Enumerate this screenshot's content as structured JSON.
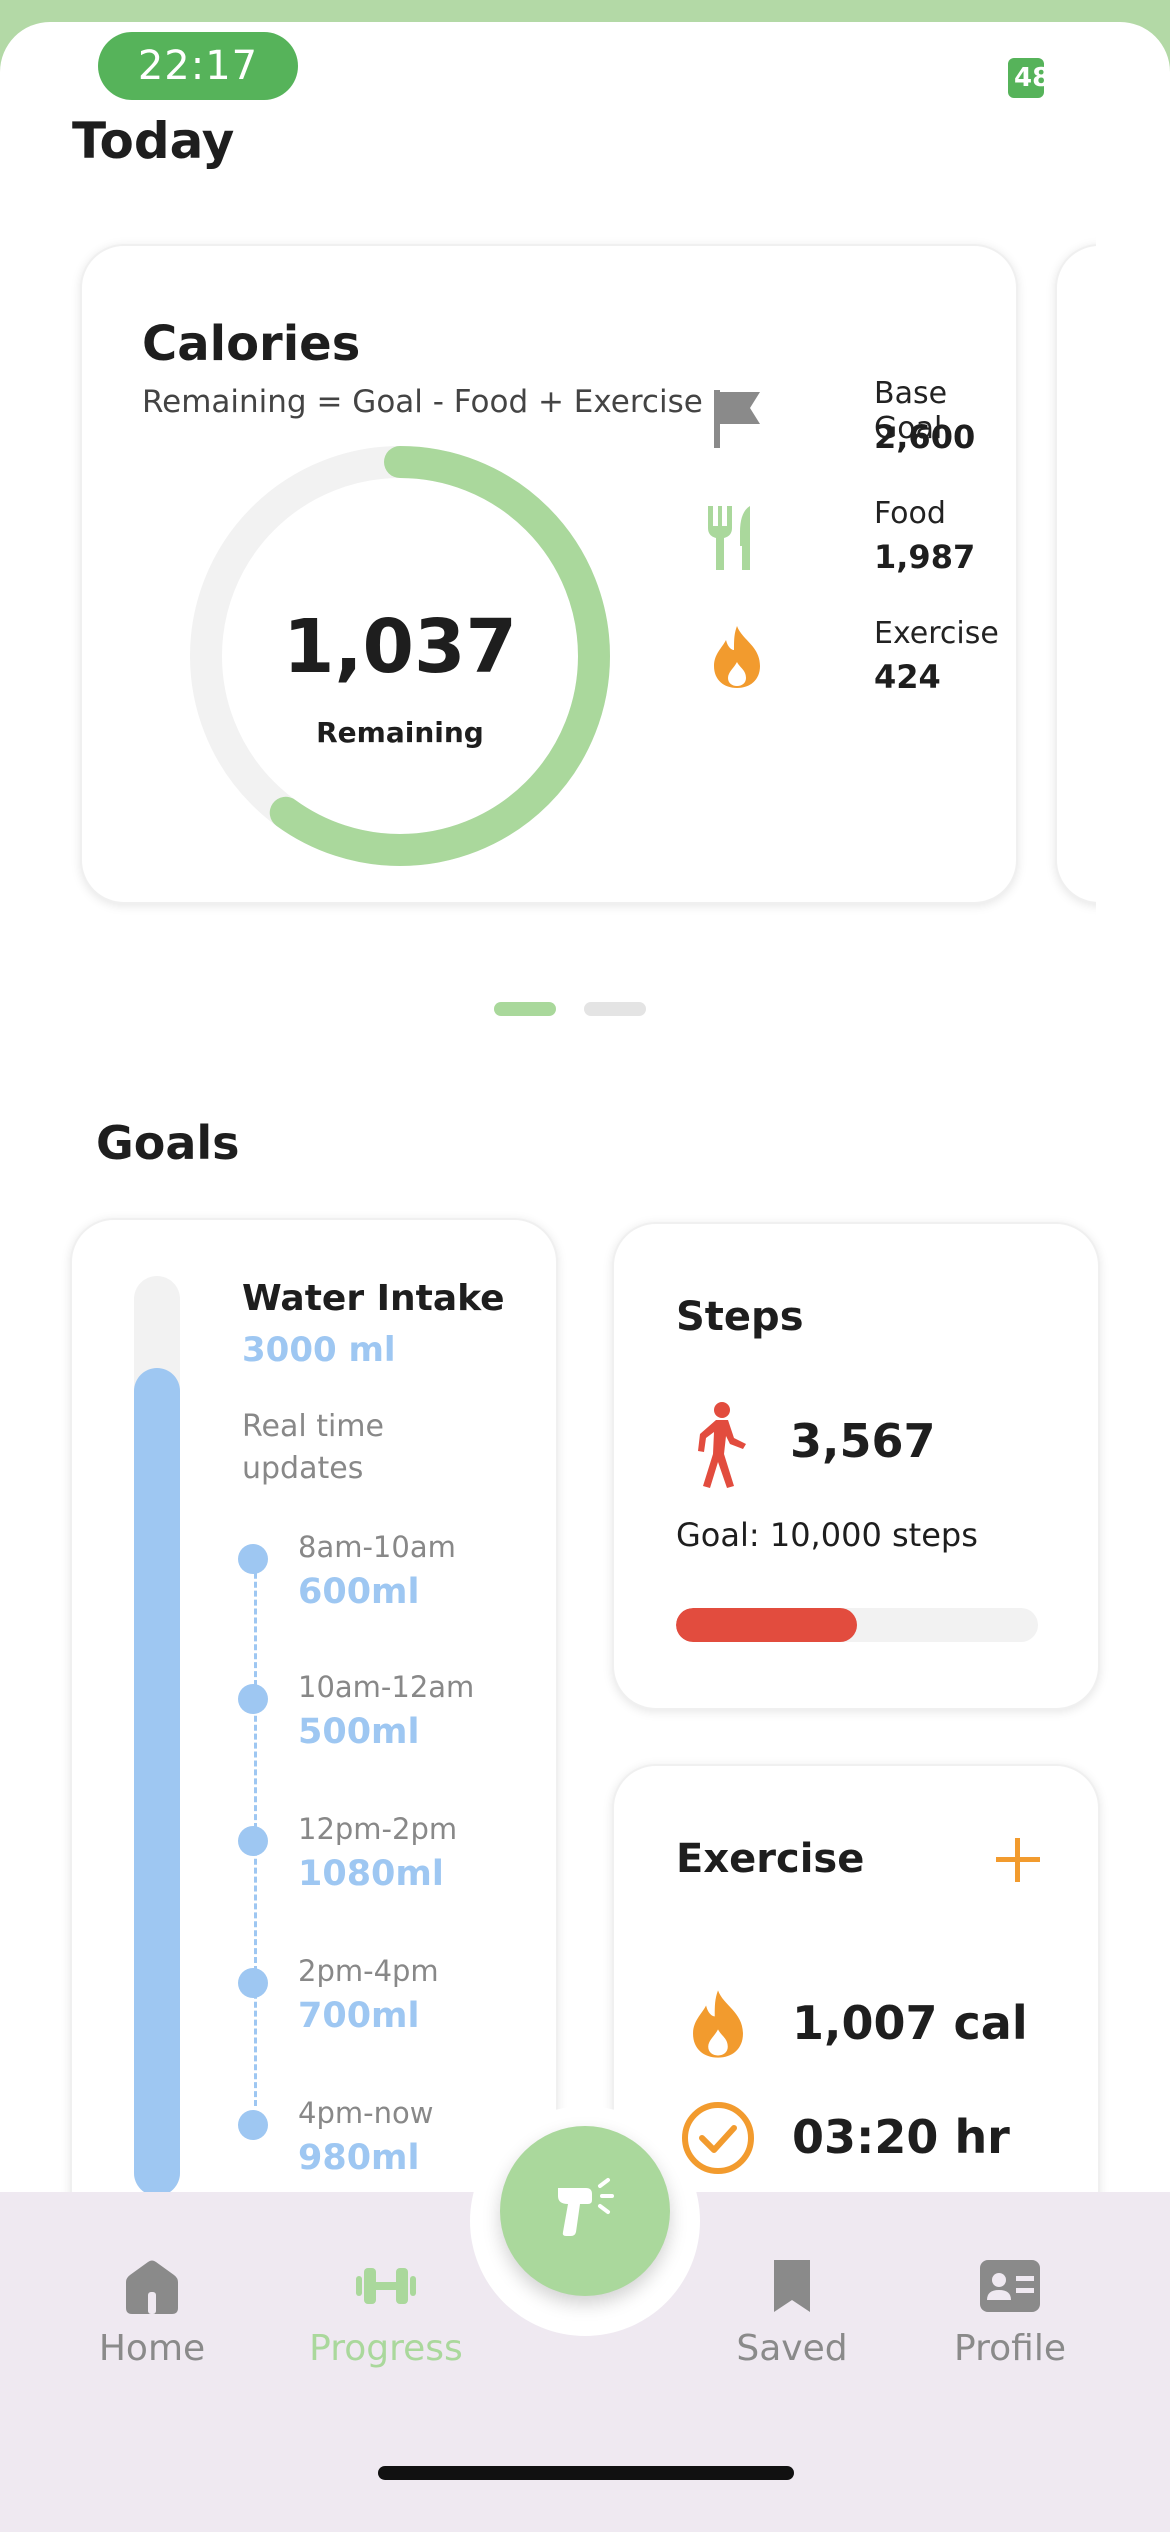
{
  "status_bar": {
    "time": "22:17",
    "battery": "48"
  },
  "page_title": "Today",
  "calories": {
    "title": "Calories",
    "subtitle": "Remaining = Goal - Food + Exercise",
    "remaining_value": "1,037",
    "remaining_label": "Remaining",
    "progress_fraction": 0.6,
    "stats": [
      {
        "label": "Base Goal",
        "value": "2,600",
        "icon": "flag-icon"
      },
      {
        "label": "Food",
        "value": "1,987",
        "icon": "utensils-icon"
      },
      {
        "label": "Exercise",
        "value": "424",
        "icon": "flame-icon"
      }
    ],
    "colors": {
      "ring": "#aad89c",
      "track": "#f2f2f2",
      "flame": "#f29b2e",
      "flag": "#8a8a8a"
    }
  },
  "carousel": {
    "page_count": 2,
    "active_index": 0
  },
  "goals": {
    "title": "Goals",
    "water": {
      "title": "Water Intake",
      "amount": "3000 ml",
      "note": "Real time updates",
      "fill_fraction": 0.9,
      "entries": [
        {
          "time": "8am-10am",
          "ml": "600ml"
        },
        {
          "time": "10am-12am",
          "ml": "500ml"
        },
        {
          "time": "12pm-2pm",
          "ml": "1080ml"
        },
        {
          "time": "2pm-4pm",
          "ml": "700ml"
        },
        {
          "time": "4pm-now",
          "ml": "980ml"
        }
      ],
      "color": "#9ec7f2"
    },
    "steps": {
      "title": "Steps",
      "value": "3,567",
      "goal": "Goal: 10,000 steps",
      "progress_fraction": 0.5,
      "color": "#e24c3e"
    },
    "exercise": {
      "title": "Exercise",
      "calories": "1,007 cal",
      "duration": "03:20 hr",
      "color": "#f29b2e"
    }
  },
  "nav": {
    "items": [
      {
        "label": "Home",
        "icon": "home-icon"
      },
      {
        "label": "Progress",
        "icon": "dumbbell-icon",
        "active": true
      },
      {
        "label": "Saved",
        "icon": "bookmark-icon"
      },
      {
        "label": "Profile",
        "icon": "profile-card-icon"
      }
    ],
    "fab_icon": "scanner-icon",
    "accent": "#aad89c"
  }
}
